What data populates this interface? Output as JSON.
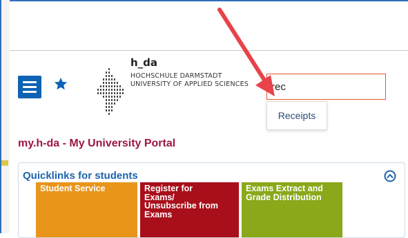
{
  "header": {
    "brand_short": "h_da",
    "brand_line1": "HOCHSCHULE DARMSTADT",
    "brand_line2": "UNIVERSITY OF APPLIED SCIENCES"
  },
  "search": {
    "value": "rec",
    "suggestion": "Receipts"
  },
  "portal": {
    "title": "my.h-da - My University Portal"
  },
  "quicklinks": {
    "title": "Quicklinks for students",
    "tiles": [
      {
        "lines": [
          "Student Service"
        ],
        "color": "#e9951c"
      },
      {
        "lines": [
          "Register for",
          "Exams/",
          "Unsubscribe from",
          "Exams"
        ],
        "color": "#a80f1b"
      },
      {
        "lines": [
          "Exams Extract and",
          "Grade Distribution"
        ],
        "color": "#8aa81a"
      }
    ]
  },
  "colors": {
    "menu_button": "#0e63b4",
    "portal_title": "#9c1743",
    "panel_title": "#1d64ad",
    "search_border": "#e4572e",
    "annotation_arrow": "#e8424a"
  },
  "icons": {
    "menu": "hamburger-icon",
    "favorite": "star-icon",
    "collapse": "chevron-up-circle-icon"
  }
}
